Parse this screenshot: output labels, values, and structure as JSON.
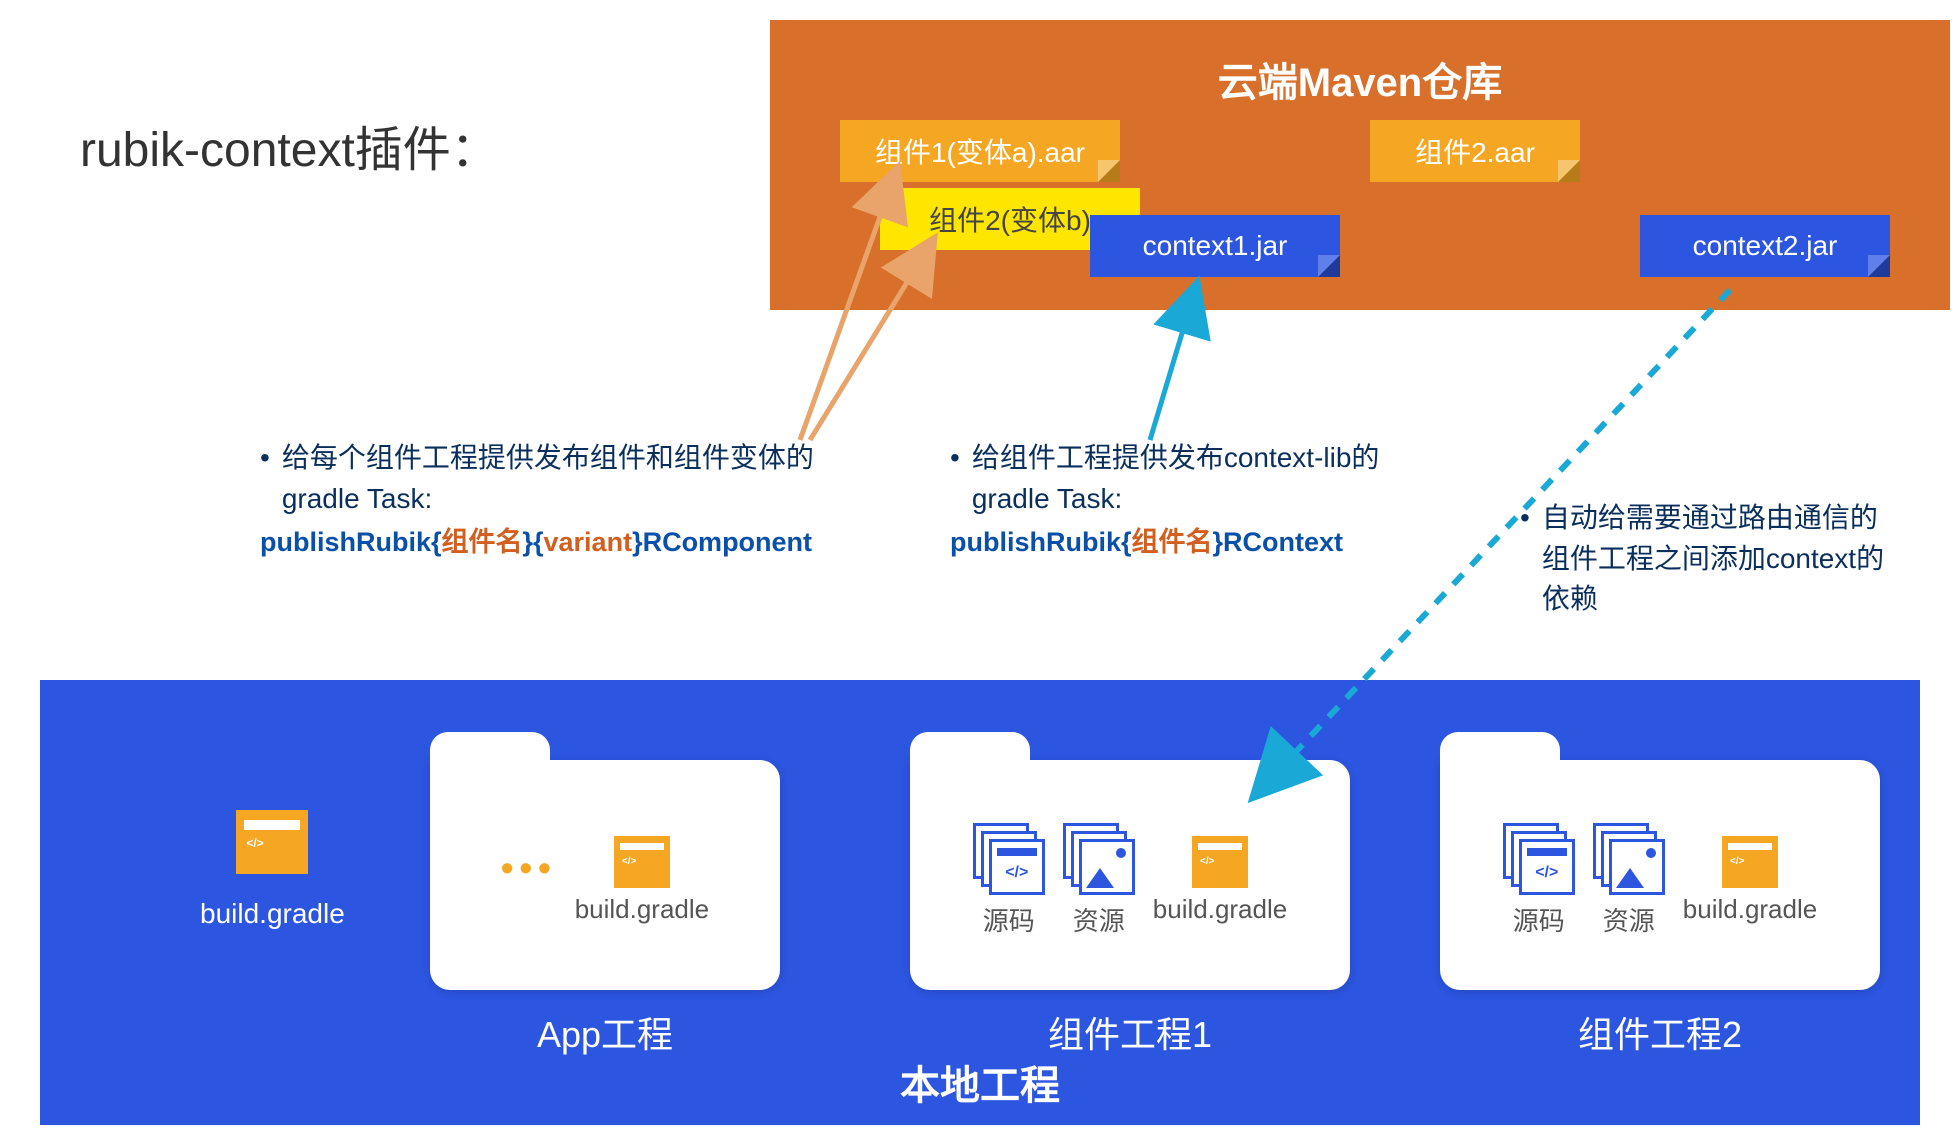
{
  "title": "rubik-context插件：",
  "maven": {
    "title": "云端Maven仓库",
    "notes": {
      "comp1_var_a": "组件1(变体a).aar",
      "comp2_var_b": "组件2(变体b)",
      "comp2_aar": "组件2.aar",
      "context1_jar": "context1.jar",
      "context2_jar": "context2.jar"
    }
  },
  "bullets": {
    "a": {
      "text": "给每个组件工程提供发布组件和组件变体的gradle Task:",
      "task_prefix": "publishRubik{",
      "task_comp": "组件名",
      "task_mid1": "}{",
      "task_variant": "variant",
      "task_suffix": "}RComponent"
    },
    "b": {
      "text": "给组件工程提供发布context-lib的gradle Task:",
      "task_prefix": "publishRubik{",
      "task_comp": "组件名",
      "task_suffix": "}RContext"
    },
    "c": {
      "text": "自动给需要通过路由通信的组件工程之间添加context的依赖"
    }
  },
  "local": {
    "title": "本地工程",
    "root_build_gradle": "build.gradle",
    "folders": {
      "app": {
        "title": "App工程",
        "build_gradle": "build.gradle"
      },
      "comp1": {
        "title": "组件工程1",
        "source": "源码",
        "resource": "资源",
        "build_gradle": "build.gradle"
      },
      "comp2": {
        "title": "组件工程2",
        "source": "源码",
        "resource": "资源",
        "build_gradle": "build.gradle"
      }
    }
  },
  "colors": {
    "blue": "#2c55e0",
    "orange_box": "#d86f2a",
    "amber": "#f5a623",
    "yellow": "#ffe600",
    "dark_navy": "#0a2f5c",
    "task_blue": "#0a4fa8",
    "task_orange": "#d25f1f",
    "cyan_arrow": "#1aa9d6"
  }
}
